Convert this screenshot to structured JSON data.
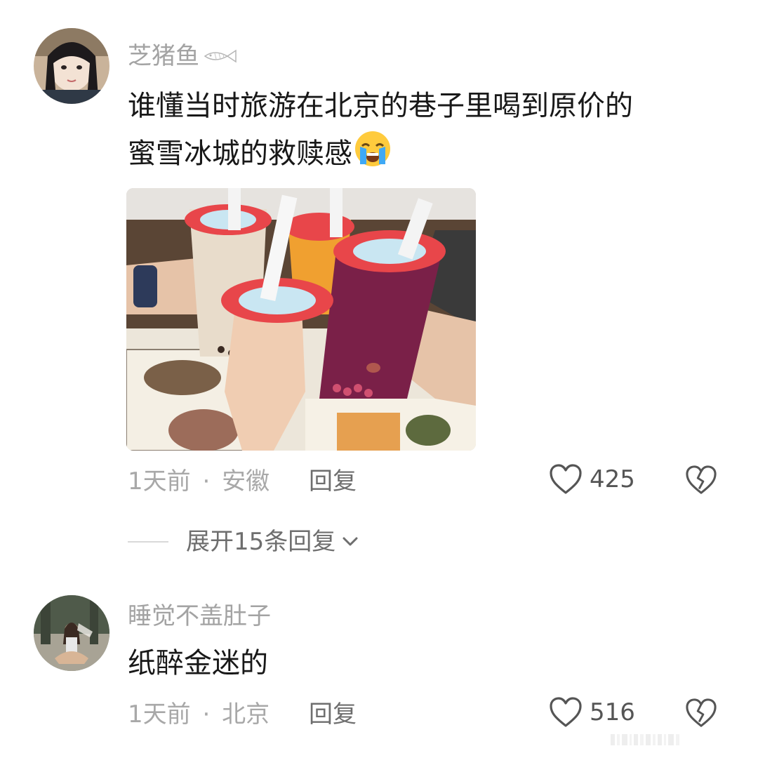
{
  "comments": [
    {
      "username": "芝猪鱼",
      "text_line1": "谁懂当时旅游在北京的巷子里喝到原价的",
      "text_line2": "蜜雪冰城的救赎感",
      "emoji": "loudly-crying-face",
      "time": "1天前",
      "separator": "·",
      "location": "安徽",
      "reply_label": "回复",
      "likes": "425",
      "expand_label": "展开15条回复"
    },
    {
      "username": "睡觉不盖肚子",
      "text_line1": "纸醉金迷的",
      "time": "1天前",
      "separator": "·",
      "location": "北京",
      "reply_label": "回复",
      "likes": "516"
    }
  ],
  "colors": {
    "background": "#ffffff",
    "username": "#a3a3a3",
    "comment": "#181818",
    "meta": "#a8a8a8",
    "cup_lid": "#e8464a"
  }
}
